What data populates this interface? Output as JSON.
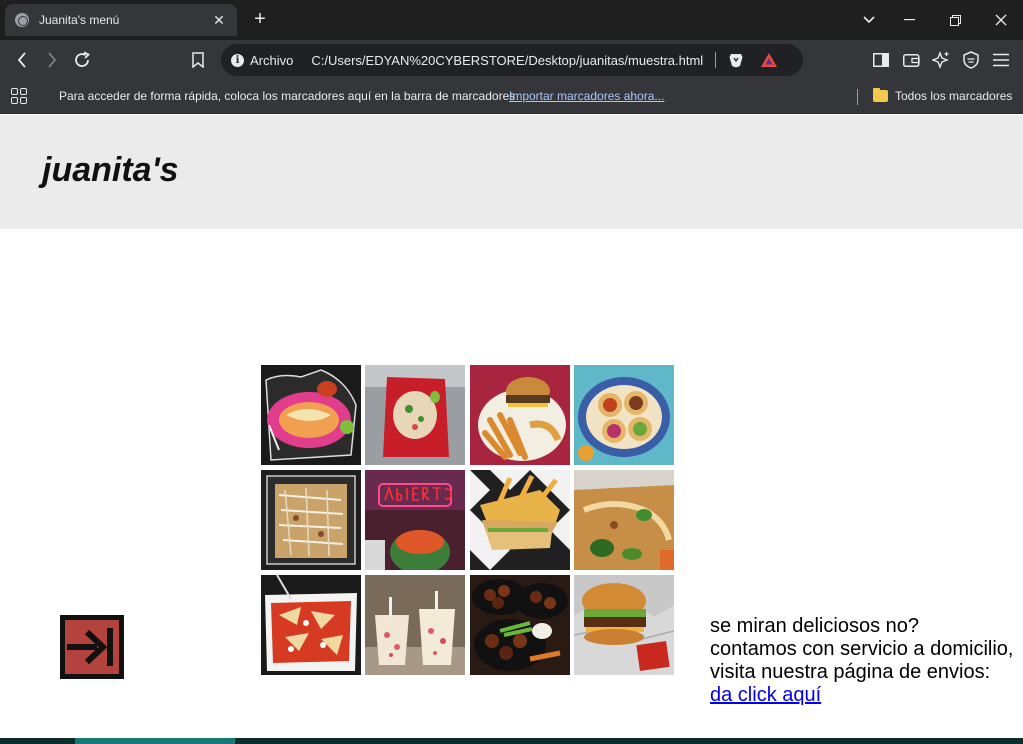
{
  "browser": {
    "tab_title": "Juanita's menú",
    "tab_close": "✕",
    "new_tab": "+",
    "scheme_label": "Archivo",
    "url": "C:/Users/EDYAN%20CYBERSTORE/Desktop/juanitas/muestra.html",
    "bookmarks_prompt": "Para acceder de forma rápida, coloca los marcadores aquí en la barra de marcadores",
    "bookmarks_import_link": "Importar marcadores ahora...",
    "all_bookmarks": "Todos los marcadores"
  },
  "page": {
    "title": "juanita's",
    "promo": {
      "line1": "se miran deliciosos no?",
      "line2": "contamos con servicio a domicilio,",
      "line3": "visita nuestra página de envios:",
      "link_text": "da click aquí"
    }
  },
  "gallery": [
    {
      "icon": "enchiladas-photo"
    },
    {
      "icon": "ceviche-photo"
    },
    {
      "icon": "burger-fries-photo"
    },
    {
      "icon": "tacos-photo"
    },
    {
      "icon": "pizza-photo"
    },
    {
      "icon": "open-sign-snacks-photo"
    },
    {
      "icon": "club-sandwich-photo"
    },
    {
      "icon": "nachos-photo"
    },
    {
      "icon": "chilaquiles-photo"
    },
    {
      "icon": "fruit-cups-photo"
    },
    {
      "icon": "boneless-wings-photo"
    },
    {
      "icon": "burger-foil-photo"
    }
  ],
  "colors": {
    "header_bg": "#ebebeb",
    "exit_button": "#b3433c",
    "footer": "#0d2b2b",
    "footer_accent": "#137b73"
  }
}
